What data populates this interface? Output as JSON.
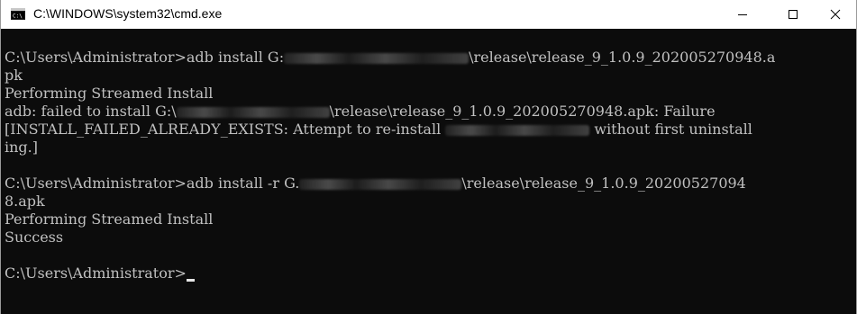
{
  "window": {
    "title": "C:\\WINDOWS\\system32\\cmd.exe",
    "icon": "cmd-console-icon"
  },
  "controls": {
    "minimize_icon": "minimize-icon",
    "maximize_icon": "maximize-icon",
    "close_icon": "close-icon"
  },
  "console": {
    "lines": [
      {
        "pre": "C:\\Users\\Administrator>adb install G:",
        "post": "\\release\\release_9_1.0.9_202005270948.a"
      },
      {
        "text": "pk"
      },
      {
        "text": "Performing Streamed Install"
      },
      {
        "pre": "adb: failed to install G:\\",
        "post": "\\release\\release_9_1.0.9_202005270948.apk: Failure"
      },
      {
        "pre": "[INSTALL_FAILED_ALREADY_EXISTS: Attempt to re-install ",
        "post": " without first uninstall"
      },
      {
        "text": "ing.]"
      },
      {
        "text": ""
      },
      {
        "pre": "C:\\Users\\Administrator>adb install -r G.",
        "post": "\\release\\release_9_1.0.9_20200527094"
      },
      {
        "text": "8.apk"
      },
      {
        "text": "Performing Streamed Install"
      },
      {
        "text": "Success"
      },
      {
        "text": ""
      },
      {
        "text": "C:\\Users\\Administrator>"
      }
    ]
  },
  "colors": {
    "console_bg": "#0c0c0c",
    "console_text": "#c0c0c0",
    "titlebar_bg": "#ffffff"
  }
}
